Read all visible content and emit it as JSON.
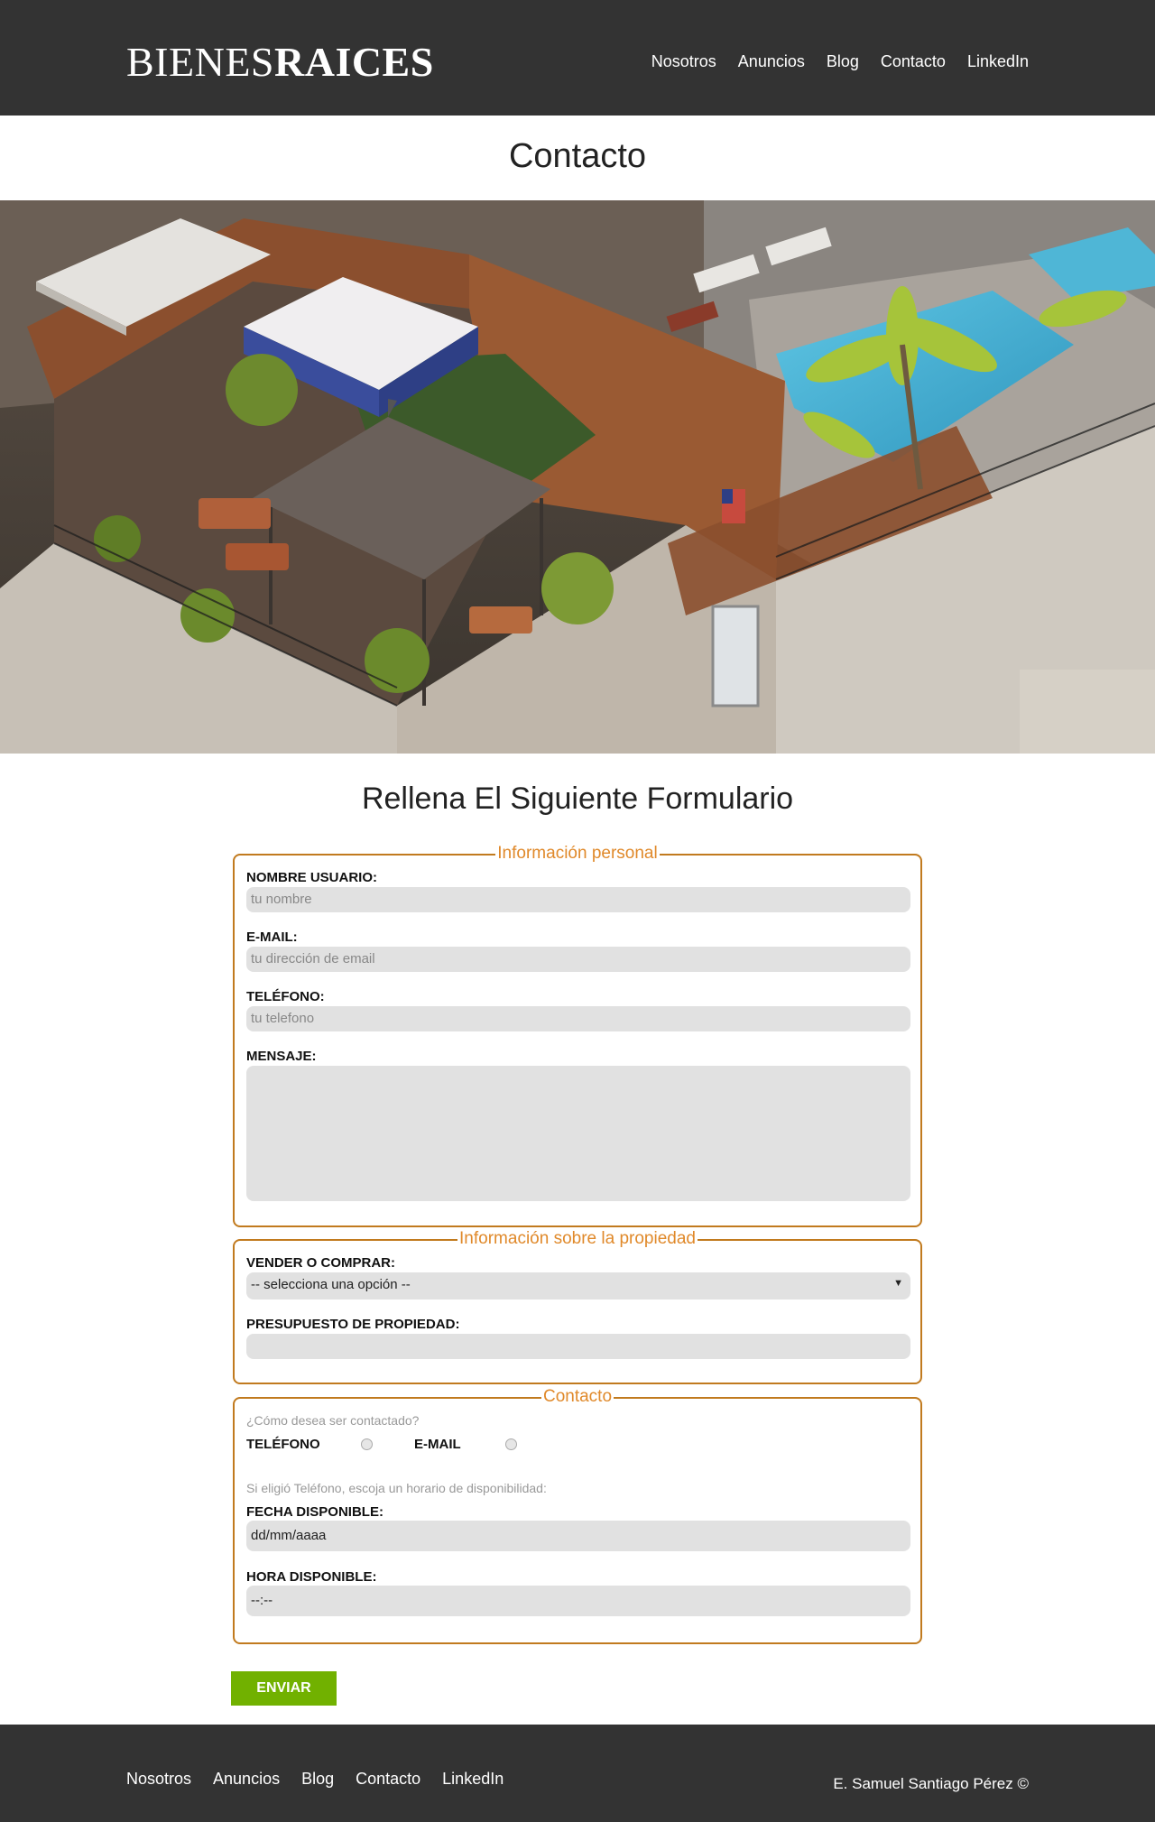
{
  "header": {
    "logo_regular": "BIENES",
    "logo_bold": "RAICES",
    "nav": [
      "Nosotros",
      "Anuncios",
      "Blog",
      "Contacto",
      "LinkedIn"
    ]
  },
  "page_title": "Contacto",
  "form_title": "Rellena El Siguiente Formulario",
  "personal": {
    "legend": "Información personal",
    "name_label": "Nombre Usuario:",
    "name_placeholder": "tu nombre",
    "email_label": "E-mail:",
    "email_placeholder": "tu dirección de email",
    "phone_label": "Teléfono:",
    "phone_placeholder": "tu telefono",
    "message_label": "Mensaje:"
  },
  "property": {
    "legend": "Información sobre la propiedad",
    "buy_sell_label": "Vender o Comprar:",
    "buy_sell_value": "-- selecciona una opción --",
    "budget_label": "Presupuesto de Propiedad:"
  },
  "contact": {
    "legend": "Contacto",
    "question": "¿Cómo desea ser contactado?",
    "option_phone": "Teléfono",
    "option_email": "E-mail",
    "schedule_hint": "Si eligió Teléfono, escoja un horario de disponibilidad:",
    "date_label": "Fecha Disponible:",
    "date_value": "dd/mm/aaaa",
    "time_label": "Hora Disponible:",
    "time_value": "--:--"
  },
  "submit_label": "Enviar",
  "footer": {
    "nav": [
      "Nosotros",
      "Anuncios",
      "Blog",
      "Contacto",
      "LinkedIn"
    ],
    "copyright": "E. Samuel Santiago Pérez ©"
  },
  "colors": {
    "header_bg": "#333333",
    "accent": "#e0892a",
    "border": "#c17a1e",
    "button": "#71b100",
    "input_bg": "#e1e1e1"
  }
}
